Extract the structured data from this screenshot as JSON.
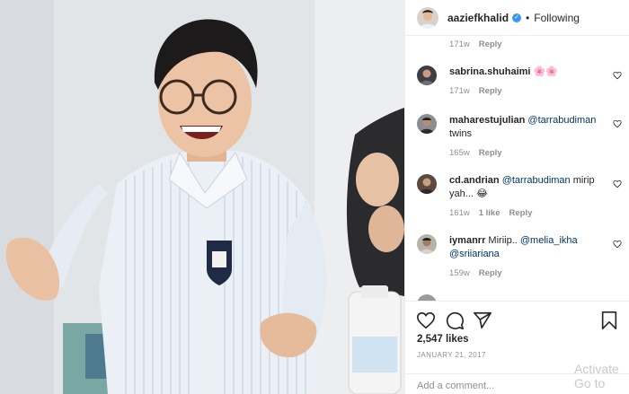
{
  "header": {
    "username": "aaziefkhalid",
    "verified_mark": "✓",
    "separator": "•",
    "follow_status": "Following"
  },
  "comments": [
    {
      "username": "",
      "text": "",
      "time": "171w",
      "reply": "Reply",
      "likes": ""
    },
    {
      "username": "sabrina.shuhaimi",
      "text": "🌸🌸",
      "time": "171w",
      "reply": "Reply",
      "likes": ""
    },
    {
      "username": "maharestujulian",
      "mention": "@tarrabudiman",
      "text": "twins",
      "time": "165w",
      "reply": "Reply",
      "likes": ""
    },
    {
      "username": "cd.andrian",
      "mention": "@tarrabudiman",
      "text": "mirip yah... 😂",
      "time": "161w",
      "reply": "Reply",
      "likes": "1 like"
    },
    {
      "username": "iymanrr",
      "pre": "Miriip..",
      "mention": "@melia_ikha",
      "mention2": "@sriiariana",
      "time": "159w",
      "reply": "Reply",
      "likes": ""
    }
  ],
  "actions": {
    "likes_count": "2,547 likes",
    "date": "JANUARY 21, 2017",
    "add_comment_placeholder": "Add a comment...",
    "icons": [
      "heart-icon",
      "comment-icon",
      "share-icon",
      "bookmark-icon"
    ]
  },
  "watermark": {
    "line1": "Activate",
    "line2": "Go to"
  },
  "colors": {
    "link": "#003569",
    "meta": "#8e8e8e",
    "verified": "#3897f0",
    "text": "#262626"
  }
}
